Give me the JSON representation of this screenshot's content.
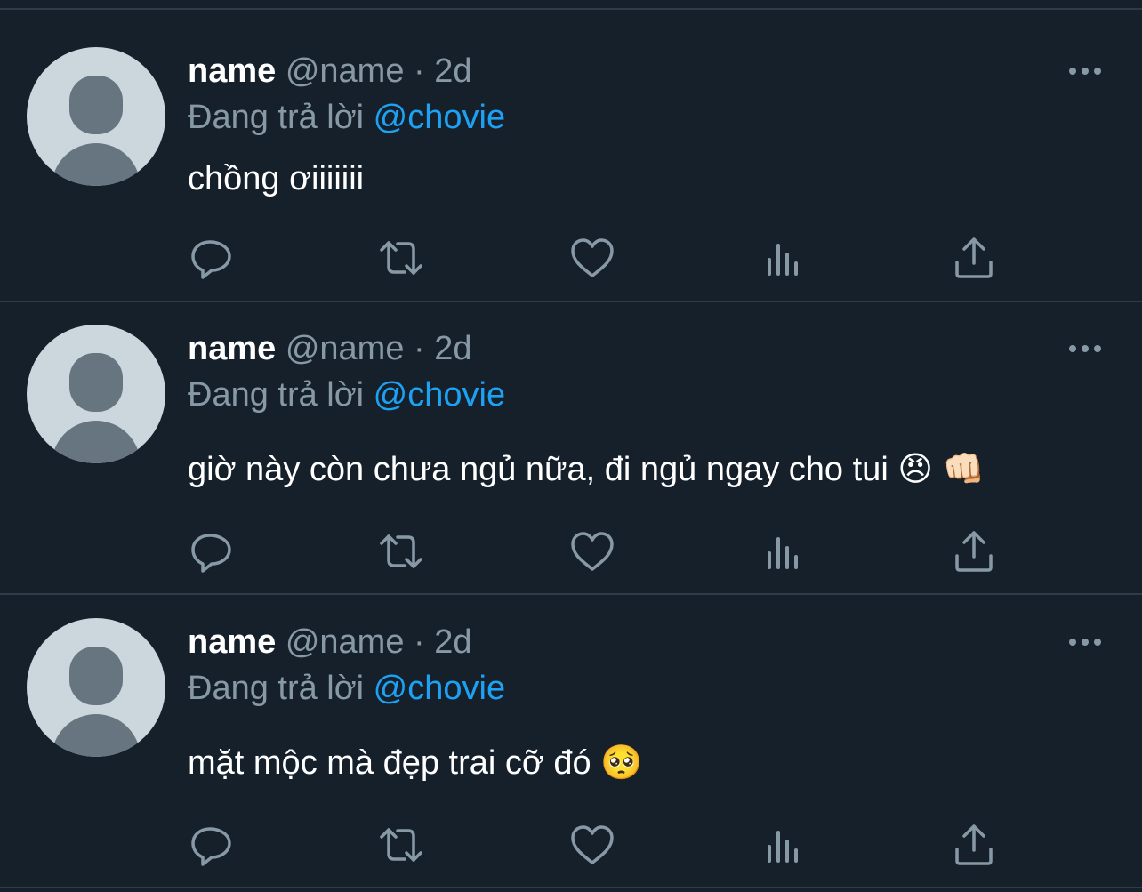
{
  "colors": {
    "background": "#15202b",
    "divider": "#2f3b47",
    "text_primary": "#ffffff",
    "text_secondary": "#8899a6",
    "accent": "#1da1f2",
    "avatar_bg": "#ccd6dd",
    "avatar_fg": "#66757f"
  },
  "tweets": [
    {
      "name": "name",
      "handle": "@name",
      "separator": "·",
      "time": "2d",
      "reply_prefix": "Đang trả lời",
      "reply_to": "@chovie",
      "text": "chồng ơiiiiiii",
      "actions": [
        "reply-icon",
        "retweet-icon",
        "like-icon",
        "analytics-icon",
        "share-icon"
      ],
      "more_icon": "more-options-icon"
    },
    {
      "name": "name",
      "handle": "@name",
      "separator": "·",
      "time": "2d",
      "reply_prefix": "Đang trả lời",
      "reply_to": "@chovie",
      "text": "giờ này còn chưa ngủ nữa, đi ngủ ngay cho tui 😠 👊🏻",
      "actions": [
        "reply-icon",
        "retweet-icon",
        "like-icon",
        "analytics-icon",
        "share-icon"
      ],
      "more_icon": "more-options-icon"
    },
    {
      "name": "name",
      "handle": "@name",
      "separator": "·",
      "time": "2d",
      "reply_prefix": "Đang trả lời",
      "reply_to": "@chovie",
      "text": "mặt mộc mà đẹp trai cỡ đó 🥺",
      "actions": [
        "reply-icon",
        "retweet-icon",
        "like-icon",
        "analytics-icon",
        "share-icon"
      ],
      "more_icon": "more-options-icon"
    }
  ]
}
